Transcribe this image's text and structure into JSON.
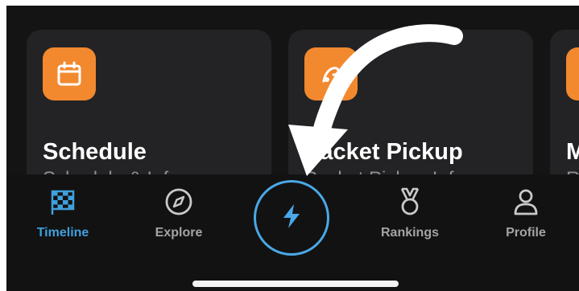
{
  "cards": [
    {
      "title": "Schedule",
      "subtitle": "Schedule & Info",
      "icon": "calendar-icon"
    },
    {
      "title": "Packet Pickup",
      "subtitle": "Packet Pickup Infor...",
      "icon": "pickup-icon"
    },
    {
      "title": "M",
      "subtitle": "Ra",
      "icon": "partial-icon"
    }
  ],
  "tabs": [
    {
      "label": "Timeline",
      "icon": "checkered-flag-icon",
      "active": true
    },
    {
      "label": "Explore",
      "icon": "compass-icon",
      "active": false
    },
    {
      "label": "",
      "icon": "lightning-icon",
      "active": false
    },
    {
      "label": "Rankings",
      "icon": "medal-icon",
      "active": false
    },
    {
      "label": "Profile",
      "icon": "person-icon",
      "active": false
    }
  ],
  "colors": {
    "accent": "#3fa0dd",
    "card_icon_bg": "#f2892f",
    "background": "#141414",
    "card_bg": "#232325"
  }
}
